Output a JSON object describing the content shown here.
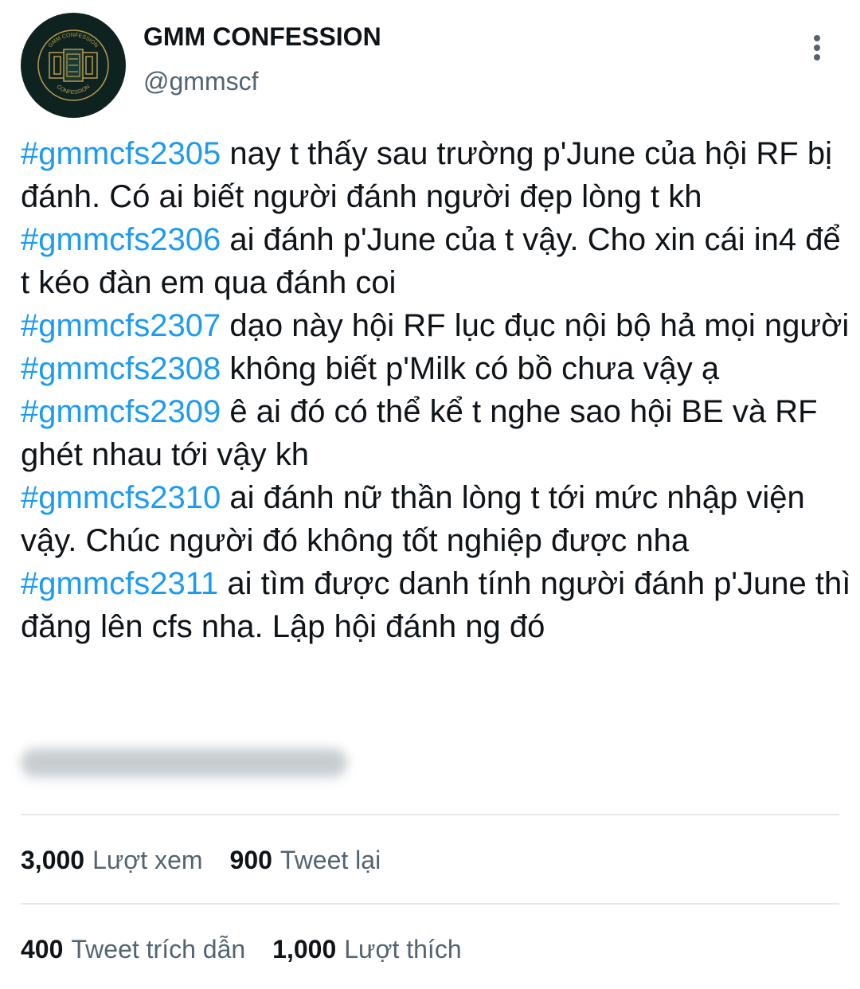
{
  "account": {
    "display_name": "GMM CONFESSION",
    "handle": "@gmmscf",
    "avatar_text_top": "GMM CONFESSION",
    "avatar_text_bottom": "CONFESSION"
  },
  "icons": {
    "more": "more-vertical-icon"
  },
  "tweet": {
    "lines": [
      {
        "tag": "#gmmcfs2305",
        "text": " nay t thấy sau trường p'June của hội RF bị đánh. Có ai biết người đánh người đẹp lòng t kh"
      },
      {
        "tag": "#gmmcfs2306",
        "text": " ai đánh p'June của t vậy. Cho xin cái in4 để t kéo đàn em qua đánh coi"
      },
      {
        "tag": "#gmmcfs2307",
        "text": " dạo này hội RF lục đục nội bộ hả mọi người"
      },
      {
        "tag": "#gmmcfs2308",
        "text": " không biết p'Milk có bồ chưa vậy ạ"
      },
      {
        "tag": "#gmmcfs2309",
        "text": " ê ai đó có thể kể t nghe sao hội BE và RF ghét nhau tới vậy kh"
      },
      {
        "tag": "#gmmcfs2310",
        "text": " ai đánh nữ thần lòng t tới mức nhập viện vậy. Chúc người đó không tốt nghiệp được nha"
      },
      {
        "tag": "#gmmcfs2311",
        "text": " ai tìm được danh tính người đánh p'June thì đăng lên cfs nha. Lập hội đánh ng đó"
      }
    ]
  },
  "stats": {
    "views_count": "3,000",
    "views_label": "Lượt xem",
    "retweets_count": "900",
    "retweets_label": "Tweet lại",
    "quotes_count": "400",
    "quotes_label": "Tweet trích dẫn",
    "likes_count": "1,000",
    "likes_label": "Lượt thích"
  },
  "colors": {
    "hashtag": "#1d9bf0",
    "secondary_text": "#536471",
    "avatar_bg": "#0e2320",
    "avatar_gold": "#b89a4e"
  }
}
